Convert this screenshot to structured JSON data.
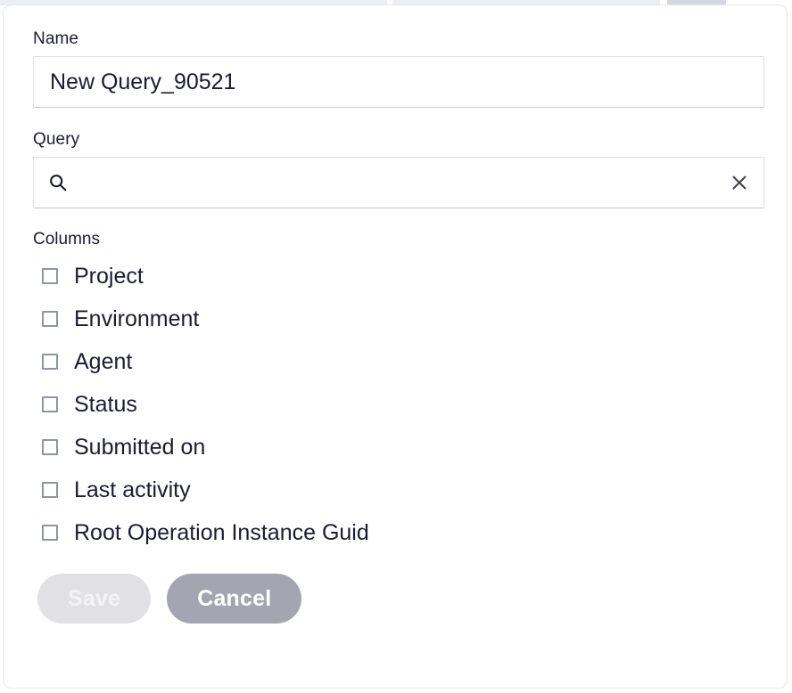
{
  "dialog": {
    "name_field": {
      "label": "Name",
      "value": "New Query_90521",
      "placeholder": ""
    },
    "query_field": {
      "label": "Query",
      "value": "",
      "placeholder": "",
      "search_icon": "search-icon",
      "clear_icon": "close-icon"
    },
    "columns": {
      "label": "Columns",
      "items": [
        {
          "label": "Project",
          "checked": false
        },
        {
          "label": "Environment",
          "checked": false
        },
        {
          "label": "Agent",
          "checked": false
        },
        {
          "label": "Status",
          "checked": false
        },
        {
          "label": "Submitted on",
          "checked": false
        },
        {
          "label": "Last activity",
          "checked": false
        },
        {
          "label": "Root Operation Instance Guid",
          "checked": false
        }
      ]
    },
    "footer": {
      "save_label": "Save",
      "cancel_label": "Cancel"
    }
  },
  "colors": {
    "text": "#1b1b33",
    "border": "#dcdee5",
    "dialog_border": "#e4e7ec",
    "save_bg": "#e1e1e4",
    "cancel_bg": "#a4a5b1",
    "checkbox_border": "#9095a3"
  }
}
